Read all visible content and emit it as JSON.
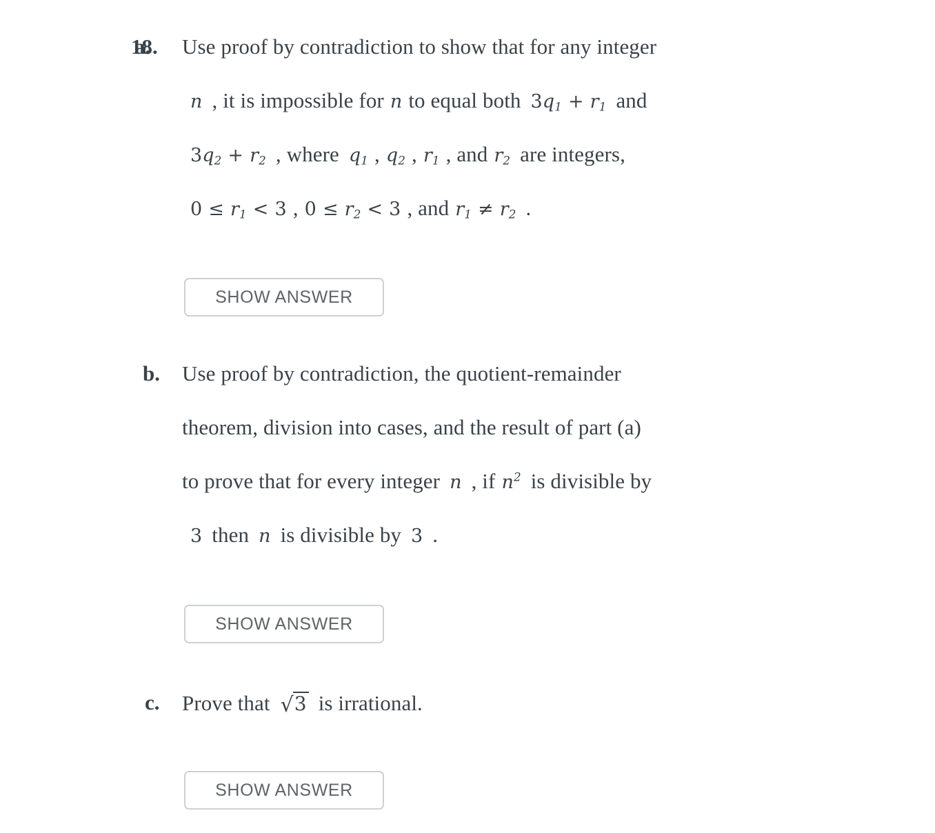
{
  "page": {
    "background": "#ffffff",
    "text_color": "#3a4249"
  },
  "question": {
    "number_label": "18.",
    "overlapped_with_part_a": true
  },
  "parts": [
    {
      "label": "a.",
      "lines": [
        "Use proof by contradiction to show that for any integer",
        "n , it is impossible for n to equal both 3q_1 + r_1 and",
        "3q_2 + r_2 , where q_1 , q_2 , r_1 , and r_2 are integers,",
        "0 ≤ r_1 < 3 , 0 ≤ r_2 < 3 , and r_1 ≠ r_2 ."
      ],
      "line1_text": "Use proof by contradiction to show that for any integer",
      "line2_pre": ", it is impossible for",
      "line2_mid": "to equal both",
      "line2_post": "and",
      "line3_pre": ", where",
      "line3_post": ", and",
      "line3_tail": "are integers,",
      "line4_and": ", and",
      "button": "SHOW ANSWER"
    },
    {
      "label": "b.",
      "lines": [
        "Use proof by contradiction, the quotient-remainder",
        "theorem, division into cases, and the result of part (a)",
        "to prove that for every integer n , if n^2 is divisible by",
        "3 then n is divisible by 3 ."
      ],
      "line1_text": "Use proof by contradiction, the quotient-remainder",
      "line2_text": "theorem, division into cases, and the result of part (a)",
      "line3_pre": "to prove that for every integer",
      "line3_mid": ", if",
      "line3_post": "is divisible by",
      "line4_then": "then",
      "line4_post": "is divisible by",
      "line4_end": ".",
      "button": "SHOW ANSWER"
    },
    {
      "label": "c.",
      "lines": [
        "Prove that √3 is irrational."
      ],
      "line1_pre": "Prove that",
      "line1_post": "is irrational.",
      "button": "SHOW ANSWER"
    }
  ],
  "math": {
    "n": "n",
    "n_squared_base": "n",
    "n_squared_exp": "2",
    "three": "3",
    "zero": "0",
    "coef3": "3",
    "q": "q",
    "r": "r",
    "sub1": "1",
    "sub2": "2",
    "plus": "+",
    "leq": "≤",
    "lt": "<",
    "neq": "≠",
    "comma": ",",
    "period": ".",
    "radical_sign": "√",
    "radicand_3": "3"
  },
  "buttons": {
    "show_answer_label": "SHOW ANSWER",
    "border_color": "#cfd0d1",
    "text_color": "#5f6368"
  }
}
